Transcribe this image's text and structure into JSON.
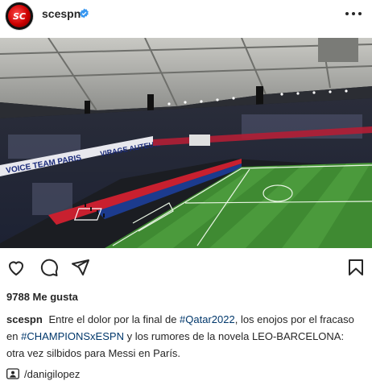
{
  "post": {
    "username": "scespn",
    "avatar_text": "SC",
    "verified": true,
    "likes": "9788 Me gusta",
    "caption": {
      "user": "scespn",
      "t1": "Entre el dolor por la final de",
      "tag1": "#Qatar2022",
      "t2": ", los enojos por el fracaso en",
      "tag2": "#CHAMPIONSxESPN",
      "t3": "y los rumores de la novela LEO-BARCELONA: otra vez silbidos para Messi en París."
    },
    "credit": "/danigilopez",
    "media_banner": "VIRAGE AUTEUIL",
    "media_banner_left": "VOICE TEAM PARIS"
  },
  "colors": {
    "verified": "#3897f0",
    "hashtag": "#00376b",
    "pitch": "#3f8a32"
  },
  "icons": [
    "avatar",
    "verified-icon",
    "more-options-icon",
    "mute-icon",
    "heart-icon",
    "comment-icon",
    "share-icon",
    "bookmark-icon",
    "tag-person-icon"
  ]
}
